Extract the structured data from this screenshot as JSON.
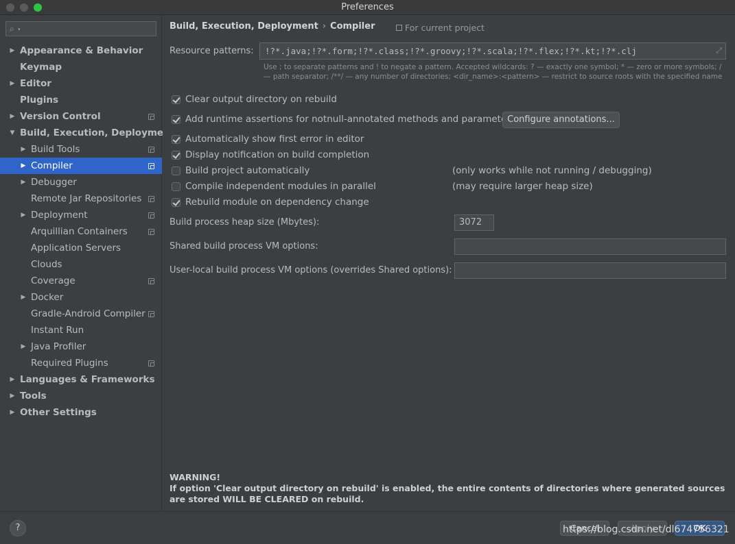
{
  "window": {
    "title": "Preferences"
  },
  "sidebar": {
    "search_placeholder": "",
    "items": [
      {
        "label": "Appearance & Behavior",
        "level": 0,
        "bold": true,
        "arrow": "right",
        "project": false,
        "selected": false
      },
      {
        "label": "Keymap",
        "level": 0,
        "bold": true,
        "arrow": "",
        "project": false,
        "selected": false
      },
      {
        "label": "Editor",
        "level": 0,
        "bold": true,
        "arrow": "right",
        "project": false,
        "selected": false
      },
      {
        "label": "Plugins",
        "level": 0,
        "bold": true,
        "arrow": "",
        "project": false,
        "selected": false
      },
      {
        "label": "Version Control",
        "level": 0,
        "bold": true,
        "arrow": "right",
        "project": true,
        "selected": false
      },
      {
        "label": "Build, Execution, Deployment",
        "level": 0,
        "bold": true,
        "arrow": "down",
        "project": false,
        "selected": false
      },
      {
        "label": "Build Tools",
        "level": 1,
        "bold": false,
        "arrow": "right",
        "project": true,
        "selected": false
      },
      {
        "label": "Compiler",
        "level": 1,
        "bold": false,
        "arrow": "right",
        "project": true,
        "selected": true
      },
      {
        "label": "Debugger",
        "level": 1,
        "bold": false,
        "arrow": "right",
        "project": false,
        "selected": false
      },
      {
        "label": "Remote Jar Repositories",
        "level": 1,
        "bold": false,
        "arrow": "",
        "project": true,
        "selected": false
      },
      {
        "label": "Deployment",
        "level": 1,
        "bold": false,
        "arrow": "right",
        "project": true,
        "selected": false
      },
      {
        "label": "Arquillian Containers",
        "level": 1,
        "bold": false,
        "arrow": "",
        "project": true,
        "selected": false
      },
      {
        "label": "Application Servers",
        "level": 1,
        "bold": false,
        "arrow": "",
        "project": false,
        "selected": false
      },
      {
        "label": "Clouds",
        "level": 1,
        "bold": false,
        "arrow": "",
        "project": false,
        "selected": false
      },
      {
        "label": "Coverage",
        "level": 1,
        "bold": false,
        "arrow": "",
        "project": true,
        "selected": false
      },
      {
        "label": "Docker",
        "level": 1,
        "bold": false,
        "arrow": "right",
        "project": false,
        "selected": false
      },
      {
        "label": "Gradle-Android Compiler",
        "level": 1,
        "bold": false,
        "arrow": "",
        "project": true,
        "selected": false
      },
      {
        "label": "Instant Run",
        "level": 1,
        "bold": false,
        "arrow": "",
        "project": false,
        "selected": false
      },
      {
        "label": "Java Profiler",
        "level": 1,
        "bold": false,
        "arrow": "right",
        "project": false,
        "selected": false
      },
      {
        "label": "Required Plugins",
        "level": 1,
        "bold": false,
        "arrow": "",
        "project": true,
        "selected": false
      },
      {
        "label": "Languages & Frameworks",
        "level": 0,
        "bold": true,
        "arrow": "right",
        "project": false,
        "selected": false
      },
      {
        "label": "Tools",
        "level": 0,
        "bold": true,
        "arrow": "right",
        "project": false,
        "selected": false
      },
      {
        "label": "Other Settings",
        "level": 0,
        "bold": true,
        "arrow": "right",
        "project": false,
        "selected": false
      }
    ]
  },
  "main": {
    "breadcrumb": [
      "Build, Execution, Deployment",
      "Compiler"
    ],
    "breadcrumb_sep": "›",
    "for_current_project": "For current project",
    "resource_patterns_label": "Resource patterns:",
    "resource_patterns_value": "!?*.java;!?*.form;!?*.class;!?*.groovy;!?*.scala;!?*.flex;!?*.kt;!?*.clj",
    "resource_patterns_hint": "Use ; to separate patterns and ! to negate a pattern. Accepted wildcards: ? — exactly one symbol; * — zero or more symbols; / — path separator; /**/ — any number of directories; <dir_name>:<pattern> — restrict to source roots with the specified name",
    "checkboxes": [
      {
        "label": "Clear output directory on rebuild",
        "checked": true,
        "note": ""
      },
      {
        "label": "Add runtime assertions for notnull-annotated methods and parameters",
        "checked": true,
        "note": ""
      },
      {
        "label": "Automatically show first error in editor",
        "checked": true,
        "note": ""
      },
      {
        "label": "Display notification on build completion",
        "checked": true,
        "note": ""
      },
      {
        "label": "Build project automatically",
        "checked": false,
        "note": "(only works while not running / debugging)"
      },
      {
        "label": "Compile independent modules in parallel",
        "checked": false,
        "note": "(may require larger heap size)"
      },
      {
        "label": "Rebuild module on dependency change",
        "checked": true,
        "note": ""
      }
    ],
    "configure_annotations_label": "Configure annotations...",
    "heap_label": "Build process heap size (Mbytes):",
    "heap_value": "3072",
    "shared_vm_label": "Shared build process VM options:",
    "shared_vm_value": "",
    "user_vm_label": "User-local build process VM options (overrides Shared options):",
    "user_vm_value": "",
    "warning_title": "WARNING!",
    "warning_text": "If option 'Clear output directory on rebuild' is enabled, the entire contents of directories where generated sources are stored WILL BE CLEARED on rebuild."
  },
  "footer": {
    "help_label": "?",
    "cancel_label": "Cancel",
    "apply_label": "Apply",
    "ok_label": "OK",
    "watermark": "https://blog.csdn.net/dl674756321"
  },
  "colors": {
    "selection": "#2f65ca",
    "background": "#3c3f41",
    "ok_button": "#365880"
  }
}
